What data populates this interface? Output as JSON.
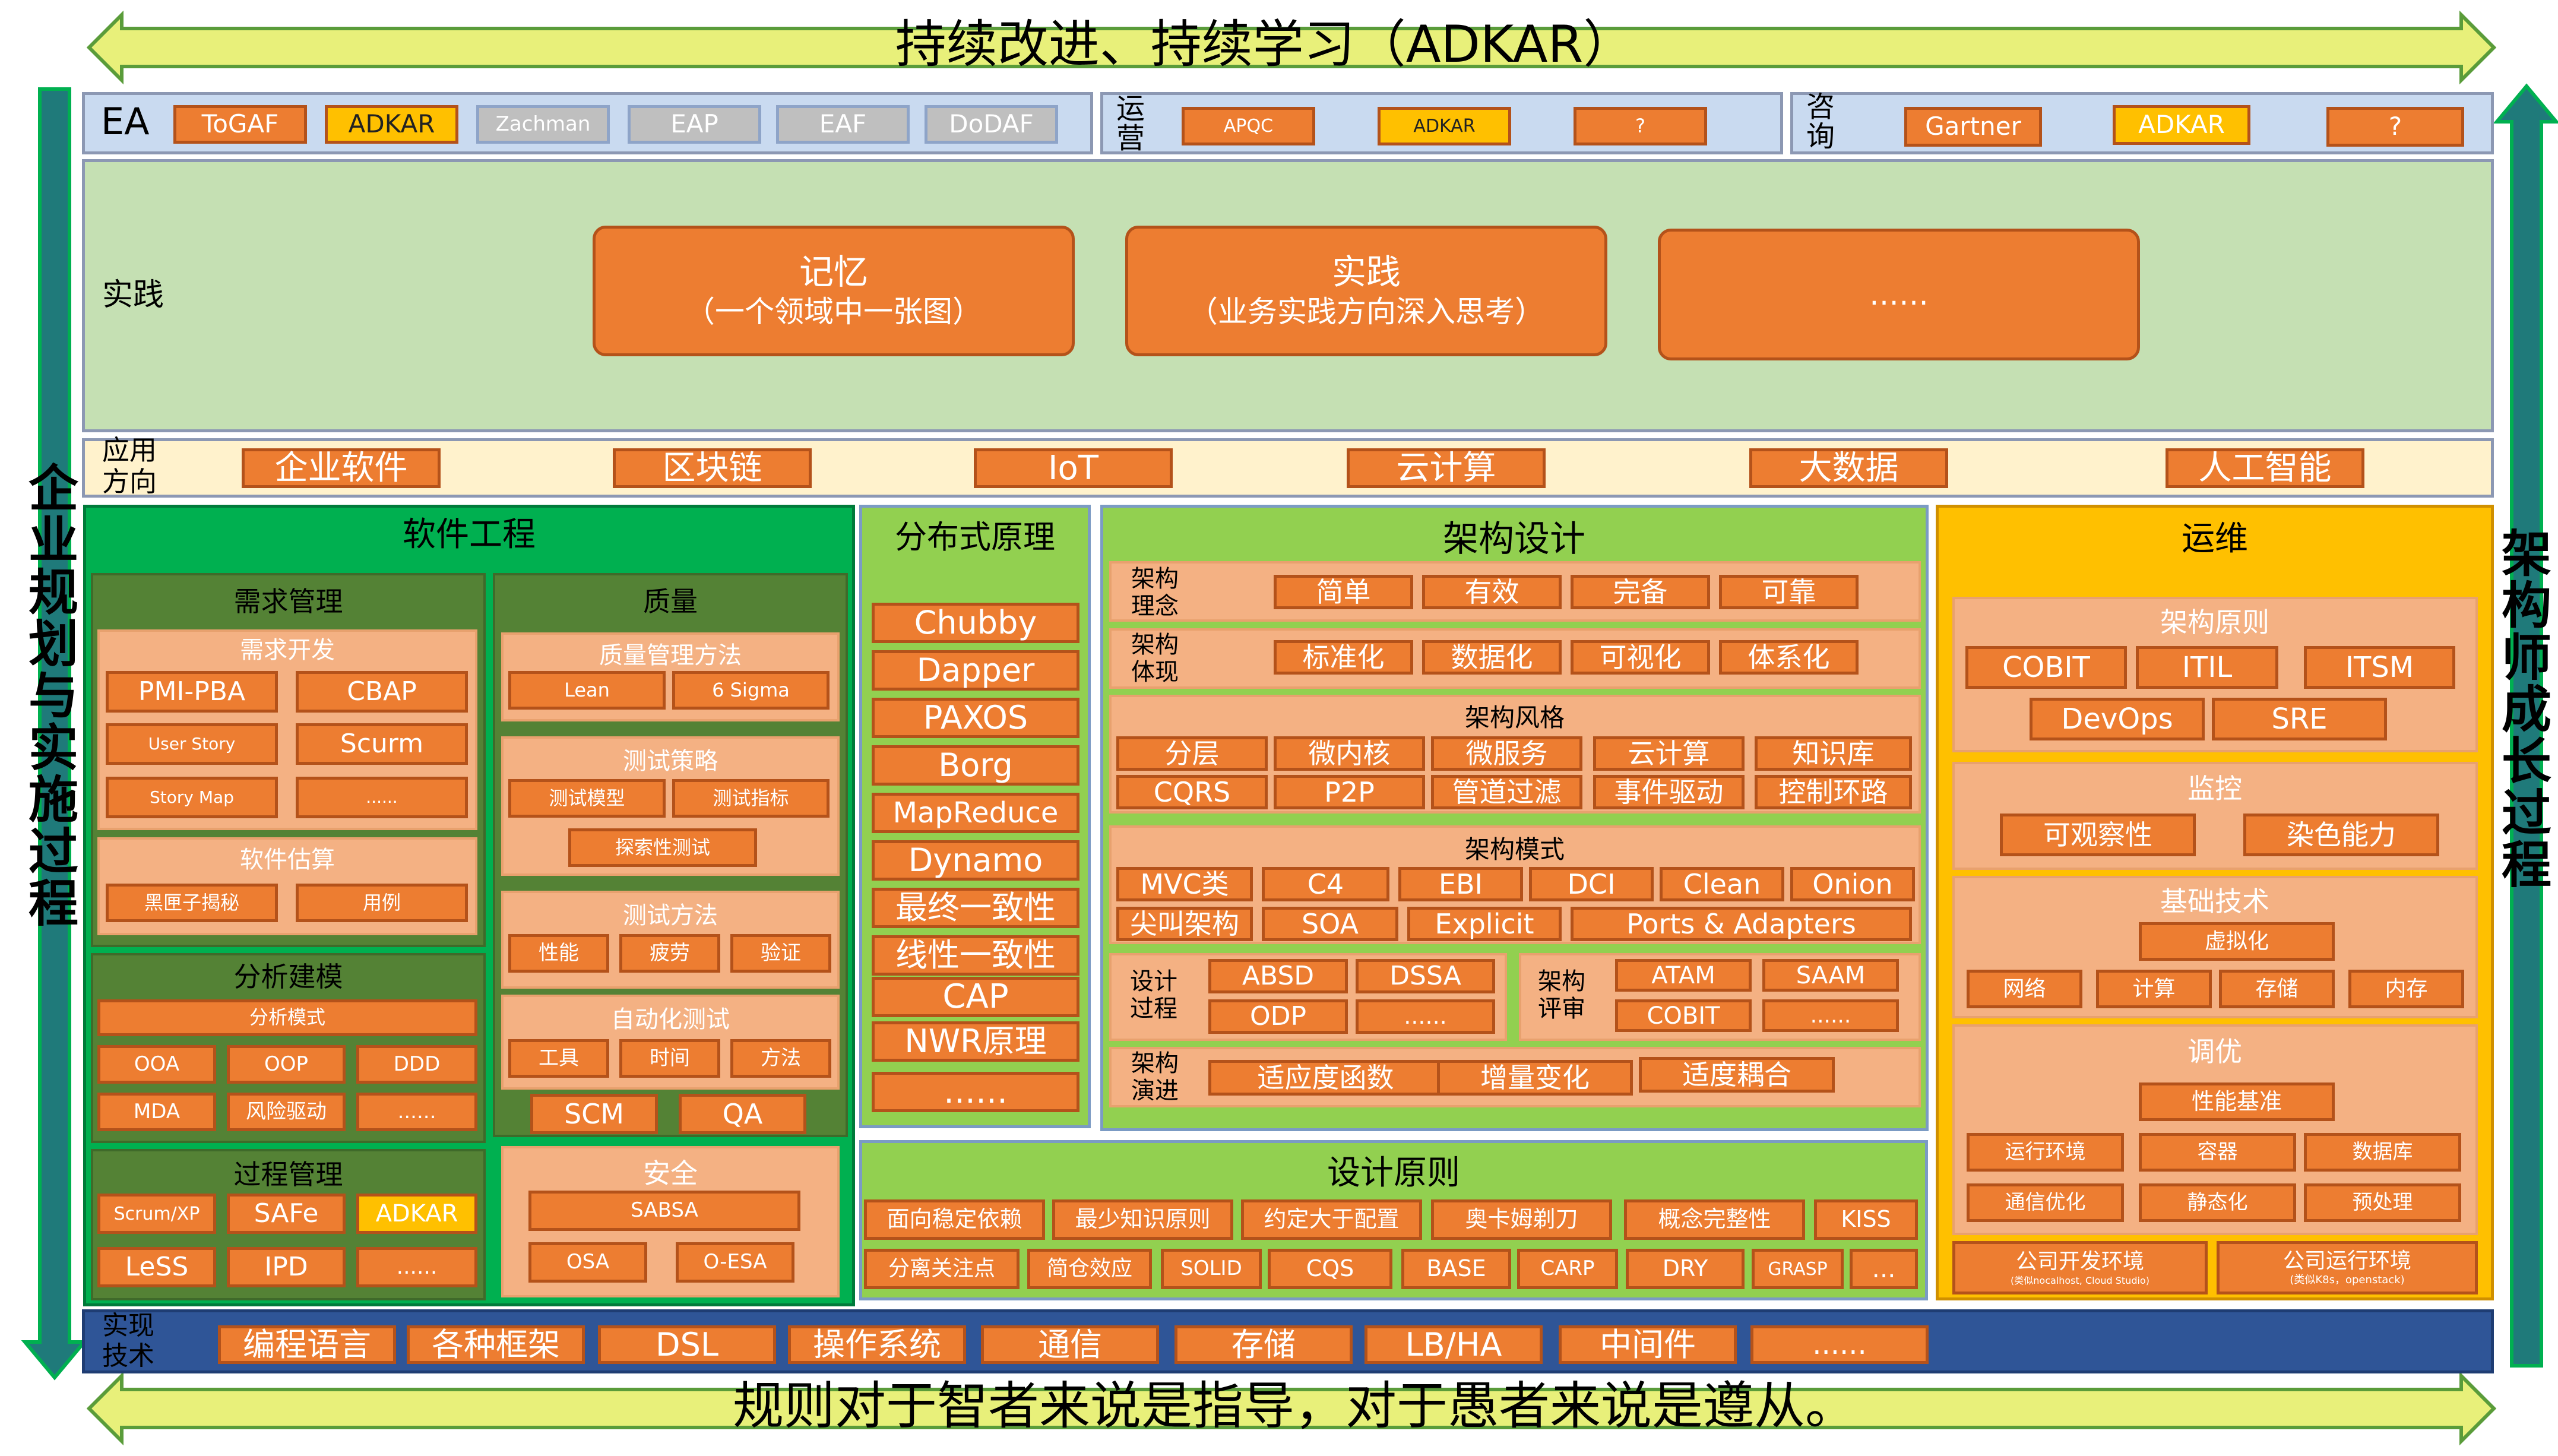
{
  "banner_top": "持续改进、持续学习（ADKAR）",
  "banner_bottom": "规则对于智者来说是指导，对于愚者来说是遵从。",
  "left_vertical": "企业规划与实施过程",
  "right_vertical": "架构师成长过程",
  "ea": {
    "label": "EA",
    "items": [
      "ToGAF",
      "ADKAR",
      "Zachman",
      "EAP",
      "EAF",
      "DoDAF"
    ]
  },
  "ops": {
    "label": "运营",
    "items": [
      "APQC",
      "ADKAR",
      "?"
    ]
  },
  "consult": {
    "label": "咨询",
    "items": [
      "Gartner",
      "ADKAR",
      "?"
    ]
  },
  "practice": {
    "label": "实践",
    "items": [
      {
        "title": "记忆",
        "sub": "（一个领域中一张图）"
      },
      {
        "title": "实践",
        "sub": "（业务实践方向深入思考）"
      },
      {
        "title": "……",
        "sub": ""
      }
    ]
  },
  "app": {
    "label": "应用方向",
    "items": [
      "企业软件",
      "区块链",
      "IoT",
      "云计算",
      "大数据",
      "人工智能"
    ]
  },
  "se": {
    "title": "软件工程",
    "req": {
      "title": "需求管理",
      "dev_title": "需求开发",
      "dev": [
        "PMI-PBA",
        "CBAP",
        "User Story",
        "Scurm",
        "Story Map",
        "......"
      ],
      "est_title": "软件估算",
      "est": [
        "黑匣子揭秘",
        "用例"
      ]
    },
    "ana": {
      "title": "分析建模",
      "pattern": "分析模式",
      "items": [
        "OOA",
        "OOP",
        "DDD",
        "MDA",
        "风险驱动",
        "......"
      ]
    },
    "proc": {
      "title": "过程管理",
      "items": [
        "Scrum/XP",
        "SAFe",
        "ADKAR",
        "LeSS",
        "IPD",
        "......"
      ]
    },
    "qual": {
      "title": "质量",
      "m_title": "质量管理方法",
      "m": [
        "Lean",
        "6 Sigma"
      ],
      "s_title": "测试策略",
      "s": [
        "测试模型",
        "测试指标",
        "探索性测试"
      ],
      "t_title": "测试方法",
      "t": [
        "性能",
        "疲劳",
        "验证"
      ],
      "a_title": "自动化测试",
      "a": [
        "工具",
        "时间",
        "方法"
      ],
      "scm": "SCM",
      "qa": "QA"
    },
    "sec": {
      "title": "安全",
      "items": [
        "SABSA",
        "OSA",
        "O-ESA"
      ]
    }
  },
  "dist": {
    "title": "分布式原理",
    "items": [
      "Chubby",
      "Dapper",
      "PAXOS",
      "Borg",
      "MapReduce",
      "Dynamo",
      "最终一致性",
      "线性一致性",
      "CAP",
      "NWR原理",
      "……"
    ]
  },
  "arch": {
    "title": "架构设计",
    "idea_label": "架构理念",
    "idea": [
      "简单",
      "有效",
      "完备",
      "可靠"
    ],
    "sys_label": "架构体现",
    "sys": [
      "标准化",
      "数据化",
      "可视化",
      "体系化"
    ],
    "style_title": "架构风格",
    "style": [
      "分层",
      "微内核",
      "微服务",
      "云计算",
      "知识库",
      "CQRS",
      "P2P",
      "管道过滤",
      "事件驱动",
      "控制环路"
    ],
    "pattern_title": "架构模式",
    "pattern": [
      "MVC类",
      "C4",
      "EBI",
      "DCI",
      "Clean",
      "Onion",
      "尖叫架构",
      "SOA",
      "Explicit",
      "Ports & Adapters"
    ],
    "dp_label": "设计过程",
    "dp": [
      "ABSD",
      "DSSA",
      "ODP",
      "......"
    ],
    "ev_label": "架构评审",
    "ev": [
      "ATAM",
      "SAAM",
      "COBIT",
      "......"
    ],
    "evo_label": "架构演进",
    "evo": [
      "适应度函数",
      "增量变化",
      "适度耦合"
    ]
  },
  "dp": {
    "title": "设计原则",
    "row1": [
      "面向稳定依赖",
      "最少知识原则",
      "约定大于配置",
      "奥卡姆剃刀",
      "概念完整性",
      "KISS"
    ],
    "row2": [
      "分离关注点",
      "简仓效应",
      "SOLID",
      "CQS",
      "BASE",
      "CARP",
      "DRY",
      "GRASP",
      "..."
    ]
  },
  "ops_section": {
    "title": "运维",
    "arch_title": "架构原则",
    "arch": [
      "COBIT",
      "ITIL",
      "ITSM",
      "DevOps",
      "SRE"
    ],
    "mon_title": "监控",
    "mon": [
      "可观察性",
      "染色能力"
    ],
    "infra_title": "基础技术",
    "virt": "虚拟化",
    "infra": [
      "网络",
      "计算",
      "存储",
      "内存"
    ],
    "tune_title": "调优",
    "bench": "性能基准",
    "tune": [
      "运行环境",
      "容器",
      "数据库",
      "通信优化",
      "静态化",
      "预处理"
    ],
    "env": [
      {
        "t": "公司开发环境",
        "s": "(类似nocalhost, Cloud Studio)"
      },
      {
        "t": "公司运行环境",
        "s": "(类似K8s，openstack)"
      }
    ]
  },
  "tech": {
    "label": "实现技术",
    "items": [
      "编程语言",
      "各种框架",
      "DSL",
      "操作系统",
      "通信",
      "存储",
      "LB/HA",
      "中间件",
      "......"
    ]
  },
  "colors": {
    "green_light": "#c5e0b3",
    "green": "#5aa33b",
    "orange": "#ed7d31",
    "yellow": "#ffc000",
    "blue": "#2f5597",
    "cream": "#fff2cc",
    "arrow": "#e8f07a"
  }
}
